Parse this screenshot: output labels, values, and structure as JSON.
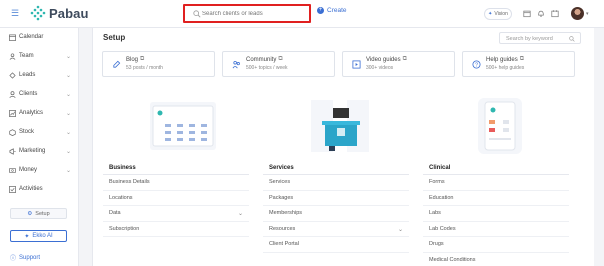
{
  "app": {
    "name": "Pabau"
  },
  "topbar": {
    "search_placeholder": "Search clients or leads",
    "create_label": "Create",
    "vision_label": "Vision"
  },
  "sidebar": {
    "items": [
      {
        "label": "Calendar",
        "icon": "calendar-icon",
        "chevron": false
      },
      {
        "label": "Team",
        "icon": "team-icon",
        "chevron": true
      },
      {
        "label": "Leads",
        "icon": "leads-icon",
        "chevron": true
      },
      {
        "label": "Clients",
        "icon": "clients-icon",
        "chevron": true
      },
      {
        "label": "Analytics",
        "icon": "analytics-icon",
        "chevron": true
      },
      {
        "label": "Stock",
        "icon": "stock-icon",
        "chevron": true
      },
      {
        "label": "Marketing",
        "icon": "marketing-icon",
        "chevron": true
      },
      {
        "label": "Money",
        "icon": "money-icon",
        "chevron": true
      },
      {
        "label": "Activities",
        "icon": "activities-icon",
        "chevron": false
      }
    ],
    "setup_label": "Setup",
    "ekko_label": "Ekko AI",
    "support_label": "Support"
  },
  "main": {
    "title": "Setup",
    "keyword_placeholder": "Search by keyword",
    "resources": [
      {
        "title": "Blog",
        "subtitle": "53 posts / month",
        "icon": "blog-icon"
      },
      {
        "title": "Community",
        "subtitle": "500+ topics / week",
        "icon": "community-icon"
      },
      {
        "title": "Video guides",
        "subtitle": "300+ videos",
        "icon": "video-icon"
      },
      {
        "title": "Help guides",
        "subtitle": "500+ help guides",
        "icon": "help-icon"
      }
    ],
    "cards": [
      {
        "title": "Business",
        "rows": [
          {
            "label": "Business Details",
            "chevron": false
          },
          {
            "label": "Locations",
            "chevron": false
          },
          {
            "label": "Data",
            "chevron": true
          },
          {
            "label": "Subscription",
            "chevron": false
          }
        ]
      },
      {
        "title": "Services",
        "rows": [
          {
            "label": "Services",
            "chevron": false
          },
          {
            "label": "Packages",
            "chevron": false
          },
          {
            "label": "Memberships",
            "chevron": false
          },
          {
            "label": "Resources",
            "chevron": true
          },
          {
            "label": "Client Portal",
            "chevron": false
          }
        ]
      },
      {
        "title": "Clinical",
        "rows": [
          {
            "label": "Forms",
            "chevron": false
          },
          {
            "label": "Education",
            "chevron": false
          },
          {
            "label": "Labs",
            "chevron": false
          },
          {
            "label": "Lab Codes",
            "chevron": false
          },
          {
            "label": "Drugs",
            "chevron": false
          },
          {
            "label": "Medical Conditions",
            "chevron": false
          }
        ]
      }
    ]
  },
  "colors": {
    "accent": "#3b6fd3",
    "highlight": "#e02020",
    "logo": "#2fb7b0"
  }
}
